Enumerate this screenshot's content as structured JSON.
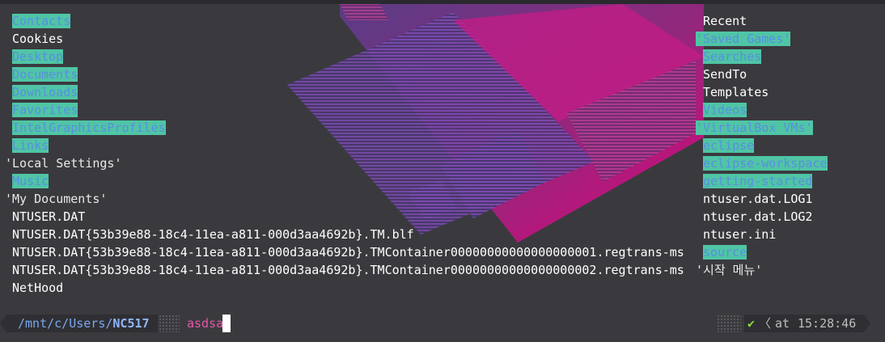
{
  "left_entries": [
    {
      "text": "Contacts",
      "kind": "dir"
    },
    {
      "text": "Cookies",
      "kind": "file"
    },
    {
      "text": "Desktop",
      "kind": "dir"
    },
    {
      "text": "Documents",
      "kind": "dir"
    },
    {
      "text": "Downloads",
      "kind": "dir"
    },
    {
      "text": "Favorites",
      "kind": "dir"
    },
    {
      "text": "IntelGraphicsProfiles",
      "kind": "dir"
    },
    {
      "text": "Links",
      "kind": "dir"
    },
    {
      "text": "'Local Settings'",
      "kind": "quoted"
    },
    {
      "text": "Music",
      "kind": "dir"
    },
    {
      "text": "'My Documents'",
      "kind": "quoted"
    },
    {
      "text": "NTUSER.DAT",
      "kind": "file"
    },
    {
      "text": "NTUSER.DAT{53b39e88-18c4-11ea-a811-000d3aa4692b}.TM.blf",
      "kind": "file"
    },
    {
      "text": "NTUSER.DAT{53b39e88-18c4-11ea-a811-000d3aa4692b}.TMContainer00000000000000000001.regtrans-ms",
      "kind": "file"
    },
    {
      "text": "NTUSER.DAT{53b39e88-18c4-11ea-a811-000d3aa4692b}.TMContainer00000000000000000002.regtrans-ms",
      "kind": "file"
    },
    {
      "text": "NetHood",
      "kind": "file"
    }
  ],
  "right_entries": [
    {
      "text": "Recent",
      "kind": "file"
    },
    {
      "text": "'Saved Games'",
      "kind": "quoted-dir"
    },
    {
      "text": "Searches",
      "kind": "dir"
    },
    {
      "text": "SendTo",
      "kind": "file"
    },
    {
      "text": "Templates",
      "kind": "file"
    },
    {
      "text": "Videos",
      "kind": "dir"
    },
    {
      "text": "'VirtualBox VMs'",
      "kind": "quoted-dir"
    },
    {
      "text": "eclipse",
      "kind": "dir"
    },
    {
      "text": "eclipse-workspace",
      "kind": "dir"
    },
    {
      "text": "getting-started",
      "kind": "dir"
    },
    {
      "text": "ntuser.dat.LOG1",
      "kind": "file"
    },
    {
      "text": "ntuser.dat.LOG2",
      "kind": "file"
    },
    {
      "text": "ntuser.ini",
      "kind": "file"
    },
    {
      "text": "source",
      "kind": "dir"
    },
    {
      "text": "'시작 메뉴'",
      "kind": "quoted"
    }
  ],
  "prompt": {
    "path_prefix": "/mnt/c/Users/",
    "path_current": "NC517",
    "command": "asdsa",
    "status_icon": "check-icon",
    "separator": "〈",
    "at_label": "at",
    "time": "15:28:46"
  },
  "colors": {
    "dir_fg": "#5a8ee0",
    "dir_bg": "#4fc5a5",
    "file_fg": "#ffffff",
    "quote_fg": "#9ee6ff",
    "command_fg": "#e857a8",
    "status_ok": "#8cd93a",
    "wallpaper_accent": "#e6007e"
  }
}
